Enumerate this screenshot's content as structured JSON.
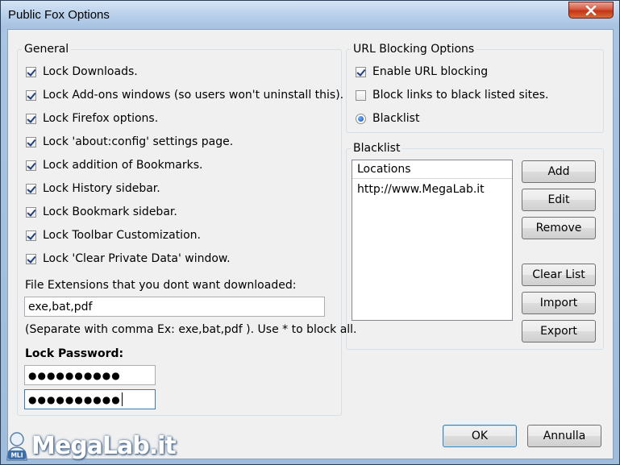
{
  "window": {
    "title": "Public Fox Options"
  },
  "general": {
    "legend": "General",
    "options": [
      {
        "label": "Lock Downloads.",
        "checked": true
      },
      {
        "label": "Lock Add-ons windows (so users won't uninstall this).",
        "checked": true
      },
      {
        "label": "Lock Firefox options.",
        "checked": true
      },
      {
        "label": "Lock 'about:config' settings page.",
        "checked": true
      },
      {
        "label": "Lock addition of Bookmarks.",
        "checked": true
      },
      {
        "label": "Lock History sidebar.",
        "checked": true
      },
      {
        "label": "Lock Bookmark sidebar.",
        "checked": true
      },
      {
        "label": "Lock Toolbar Customization.",
        "checked": true
      },
      {
        "label": "Lock 'Clear Private Data' window.",
        "checked": true
      }
    ],
    "extensions_label": "File Extensions that you dont want downloaded:",
    "extensions_value": "exe,bat,pdf",
    "extensions_hint": "(Separate with comma Ex:  exe,bat,pdf ). Use * to block all.",
    "password_label": "Lock Password:",
    "password_value": "●●●●●●●●●●",
    "password_confirm_value": "●●●●●●●●●●"
  },
  "url_blocking": {
    "legend": "URL Blocking Options",
    "enable_label": "Enable URL blocking",
    "enable_checked": true,
    "block_links_label": "Block links to black listed sites.",
    "block_links_checked": false,
    "blacklist_radio_label": "Blacklist",
    "blacklist_radio_selected": true
  },
  "blacklist": {
    "legend": "Blacklist",
    "column_header": "Locations",
    "items": [
      "http://www.MegaLab.it"
    ],
    "buttons": {
      "add": "Add",
      "edit": "Edit",
      "remove": "Remove",
      "clear": "Clear List",
      "import": "Import",
      "export": "Export"
    }
  },
  "footer": {
    "ok": "OK",
    "cancel": "Annulla"
  },
  "watermark": {
    "text": "MegaLab.it",
    "badge": "MLI"
  }
}
